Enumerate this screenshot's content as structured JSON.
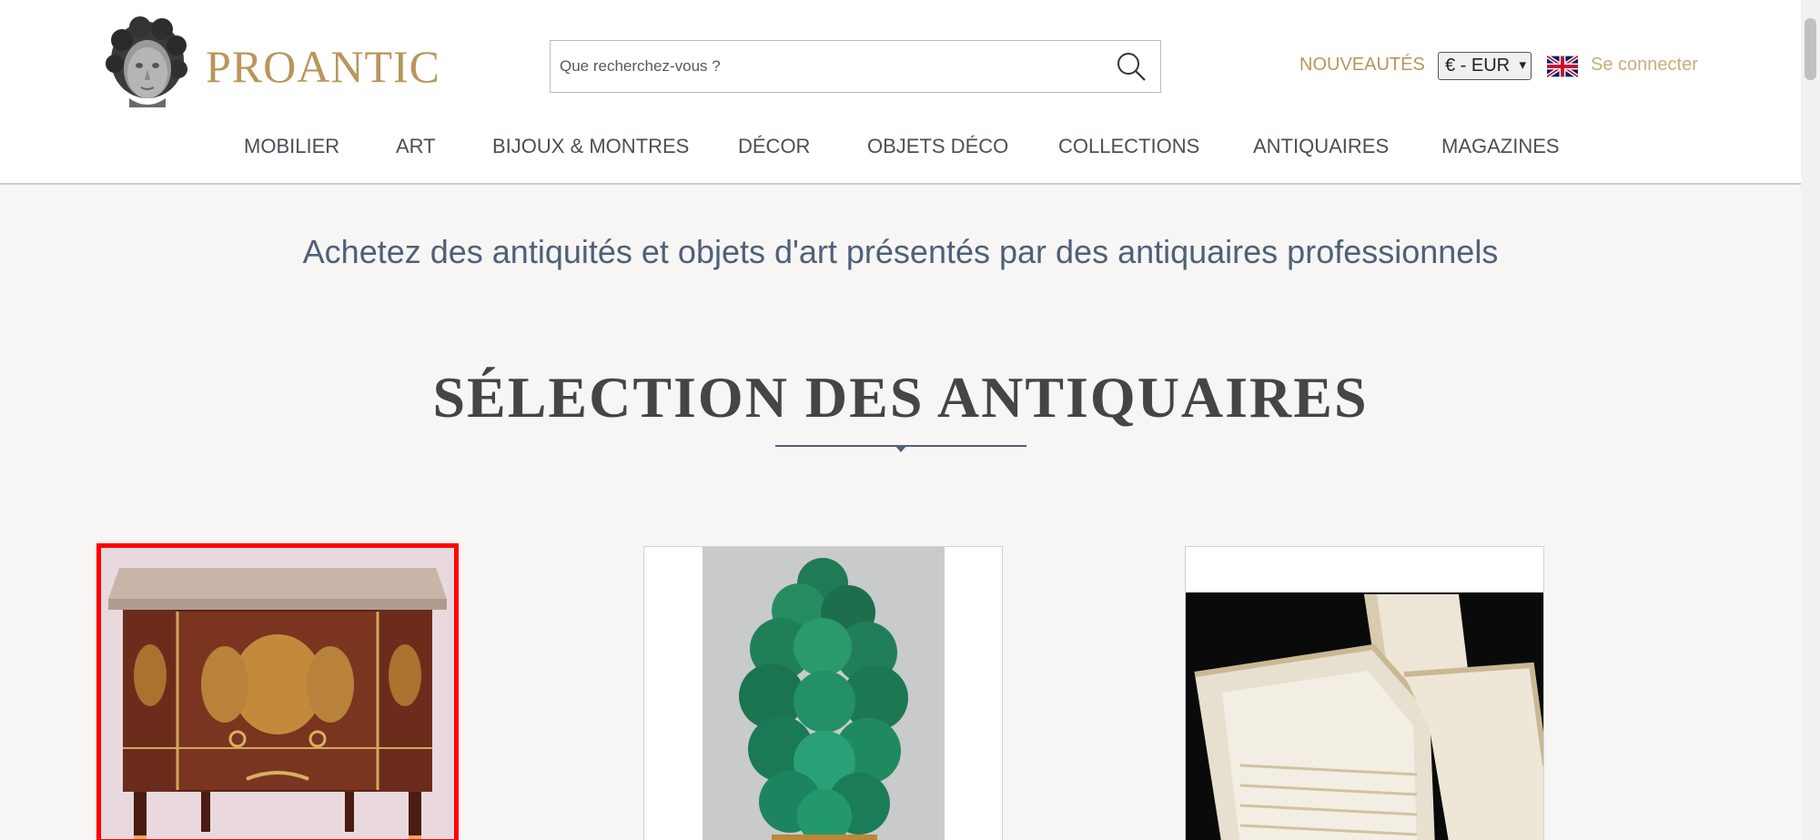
{
  "header": {
    "brand": "PROANTIC",
    "search": {
      "placeholder": "Que recherchez-vous ?",
      "value": ""
    },
    "new_label": "NOUVEAUTÉS",
    "currency": "€ - EUR",
    "login_label": "Se connecter",
    "icons": {
      "search": "search-icon",
      "flag": "uk-flag-icon",
      "logo": "cherub-head-logo"
    }
  },
  "nav": {
    "items": [
      {
        "label": "MOBILIER"
      },
      {
        "label": "ART"
      },
      {
        "label": "BIJOUX & MONTRES"
      },
      {
        "label": "DÉCOR"
      },
      {
        "label": "OBJETS DÉCO"
      },
      {
        "label": "COLLECTIONS"
      },
      {
        "label": "ANTIQUAIRES"
      },
      {
        "label": "MAGAZINES"
      }
    ]
  },
  "main": {
    "tagline": "Achetez des antiquités et objets d'art présentés par des antiquaires professionnels",
    "section_title": "SÉLECTION DES ANTIQUAIRES",
    "products": [
      {
        "image": "marquetry-commode-with-marble-top",
        "selected": true
      },
      {
        "image": "green-malachite-tree-sculpture",
        "selected": false
      },
      {
        "image": "lace-linen-napkins",
        "selected": false
      }
    ]
  },
  "colors": {
    "brand_gold": "#b8965a",
    "nav_text": "#4a4f57",
    "tagline_blue": "#4f6078",
    "selection_red": "#ff0000",
    "page_bg": "#f7f6f4"
  }
}
